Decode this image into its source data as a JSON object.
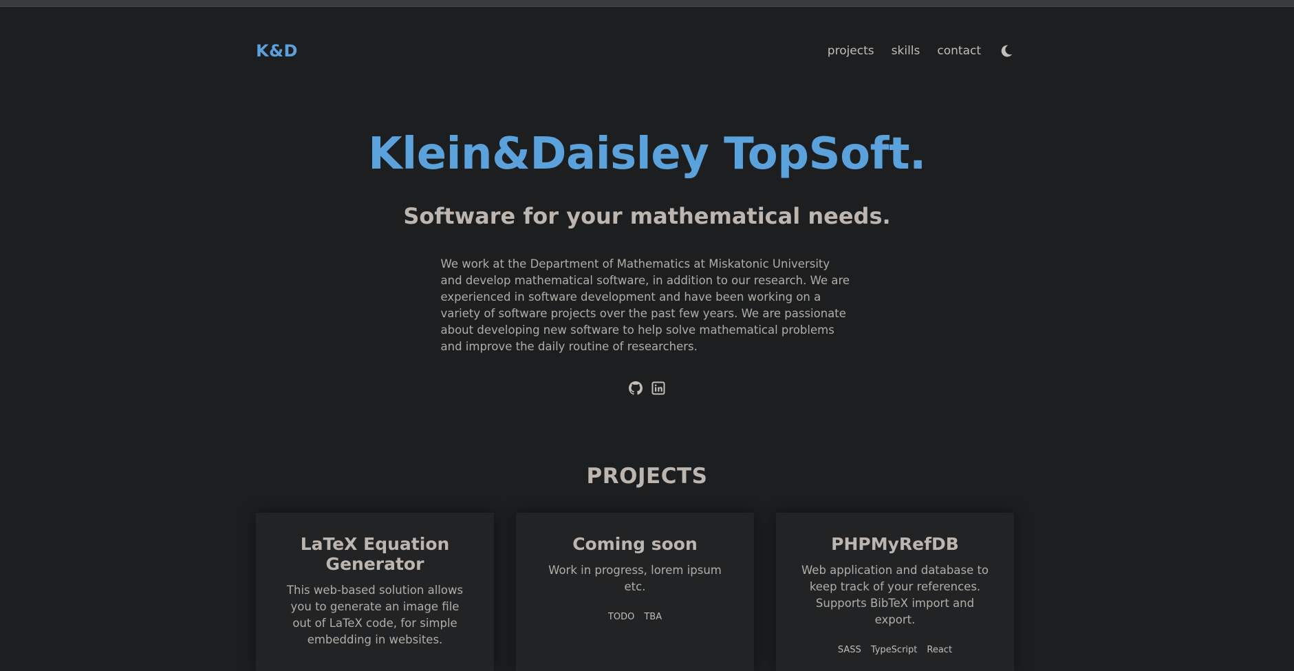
{
  "header": {
    "logo": "K&D",
    "nav": [
      "projects",
      "skills",
      "contact"
    ],
    "theme_toggle_icon": "moon-icon"
  },
  "hero": {
    "title": "Klein&Daisley TopSoft.",
    "subtitle": "Software for your mathematical needs.",
    "description": "We work at the Department of Mathematics at Miskatonic University and develop mathematical software, in addition to our research. We are experienced in software development and have been working on a variety of software projects over the past few years. We are passionate about developing new software to help solve mathematical problems and improve the daily routine of researchers.",
    "social_icons": [
      "github-icon",
      "linkedin-icon"
    ]
  },
  "projects": {
    "title": "PROJECTS",
    "items": [
      {
        "title": "LaTeX Equation Generator",
        "description": "This web-based solution allows you to generate an image file out of LaTeX code, for simple embedding in websites.",
        "tags": []
      },
      {
        "title": "Coming soon",
        "description": "Work in progress, lorem ipsum etc.",
        "tags": [
          "TODO",
          "TBA"
        ]
      },
      {
        "title": "PHPMyRefDB",
        "description": "Web application and database to keep track of your references. Supports BibTeX import and export.",
        "tags": [
          "SASS",
          "TypeScript",
          "React"
        ]
      }
    ]
  },
  "colors": {
    "accent": "#5ba1dc",
    "background": "#1d1e20",
    "card_background": "#222325",
    "text": "#b8b2ad"
  }
}
